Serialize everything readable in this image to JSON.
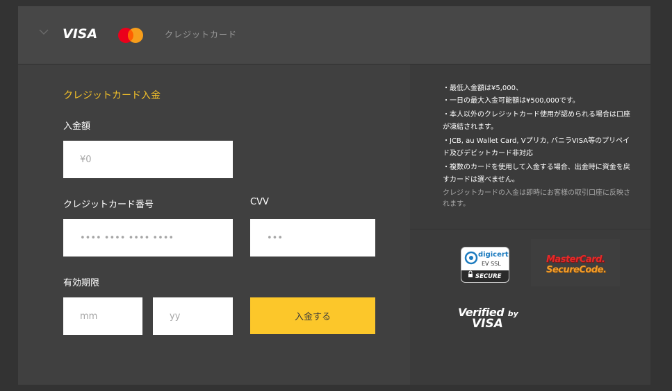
{
  "header": {
    "visa_label": "VISA",
    "card_type_label": "クレジットカード"
  },
  "form": {
    "section_title": "クレジットカード入金",
    "amount_label": "入金額",
    "amount_placeholder": "¥0",
    "card_number_label": "クレジットカード番号",
    "card_number_placeholder": "•••• •••• •••• ••••",
    "cvv_label": "CVV",
    "cvv_placeholder": "•••",
    "expiry_label": "有効期限",
    "month_placeholder": "mm",
    "year_placeholder": "yy",
    "submit_label": "入金する"
  },
  "notes": {
    "items": [
      "・最低入金額は¥5,000、",
      "・一日の最大入金可能額は¥500,000です。",
      "・本人以外のクレジットカード使用が認められる場合は口座が凍結されます。",
      "・JCB, au Wallet Card, Vプリカ, バニラVISA等のプリペイド及びデビットカード非対応",
      "・複数のカードを使用して入金する場合、出金時に資金を戻すカードは選べません。"
    ],
    "footer": "クレジットカードの入金は即時にお客様の取引口座に反映されます。"
  },
  "badges": {
    "digicert_brand": "digicert",
    "digicert_ev": "EV SSL",
    "digicert_secure": "SECURE",
    "mc_line1": "MasterCard.",
    "mc_line2": "SecureCode.",
    "vbv_verified": "Verified",
    "vbv_by": "by",
    "vbv_visa": "VISA"
  },
  "colors": {
    "accent": "#f5c229",
    "button": "#fcc72a"
  }
}
